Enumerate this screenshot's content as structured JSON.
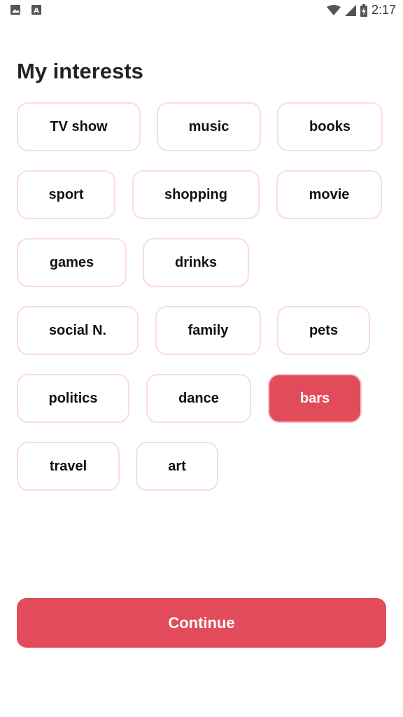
{
  "status_bar": {
    "time": "2:17",
    "left_icons": [
      "image-icon",
      "text-a-icon"
    ],
    "right_icons": [
      "wifi-icon",
      "signal-icon",
      "battery-charging-icon"
    ]
  },
  "title": "My interests",
  "interests": [
    {
      "label": "TV show",
      "selected": false
    },
    {
      "label": "music",
      "selected": false
    },
    {
      "label": "books",
      "selected": false
    },
    {
      "label": "sport",
      "selected": false
    },
    {
      "label": "shopping",
      "selected": false
    },
    {
      "label": "movie",
      "selected": false
    },
    {
      "label": "games",
      "selected": false
    },
    {
      "label": "drinks",
      "selected": false
    },
    {
      "label": "social N.",
      "selected": false
    },
    {
      "label": "family",
      "selected": false
    },
    {
      "label": "pets",
      "selected": false
    },
    {
      "label": "politics",
      "selected": false
    },
    {
      "label": "dance",
      "selected": false
    },
    {
      "label": "bars",
      "selected": true
    },
    {
      "label": "travel",
      "selected": false
    },
    {
      "label": "art",
      "selected": false
    }
  ],
  "continue_label": "Continue",
  "colors": {
    "accent": "#e24c5a",
    "chip_border": "#f9dcdf"
  }
}
